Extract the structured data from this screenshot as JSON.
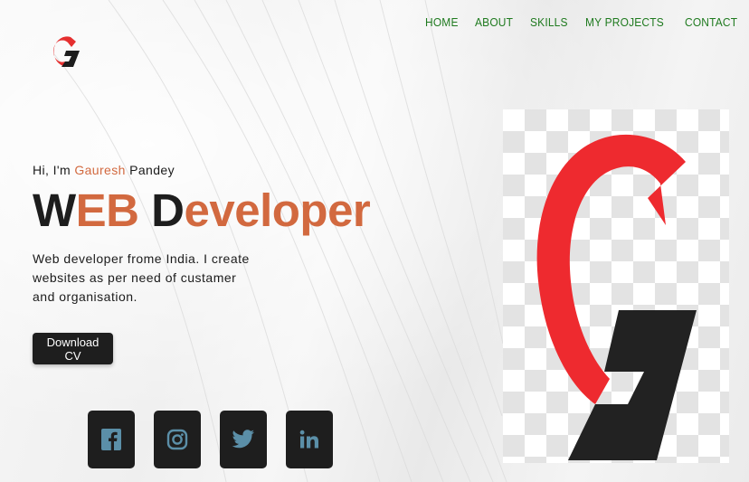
{
  "nav": {
    "items": [
      "HOME",
      "ABOUT",
      "SKILLS",
      "MY PROJECTS",
      "CONTACT"
    ]
  },
  "hero": {
    "intro_prefix": "Hi, I'm ",
    "intro_first": "Gauresh",
    "intro_last": " Pandey",
    "headline_w": "W",
    "headline_eb": "EB",
    "headline_d": " D",
    "headline_rest": "eveloper",
    "description": "Web developer frome India. I create websites as per need of custamer and organisation.",
    "cta_label": "Download CV"
  },
  "social": {
    "icons": [
      "facebook-icon",
      "instagram-icon",
      "twitter-icon",
      "linkedin-icon"
    ]
  },
  "colors": {
    "nav_text": "#1f7a1f",
    "accent_orange": "#d2693f",
    "dark": "#1d1d1d",
    "logo_red": "#e52f2f",
    "social_icon": "#5b8fa8"
  }
}
